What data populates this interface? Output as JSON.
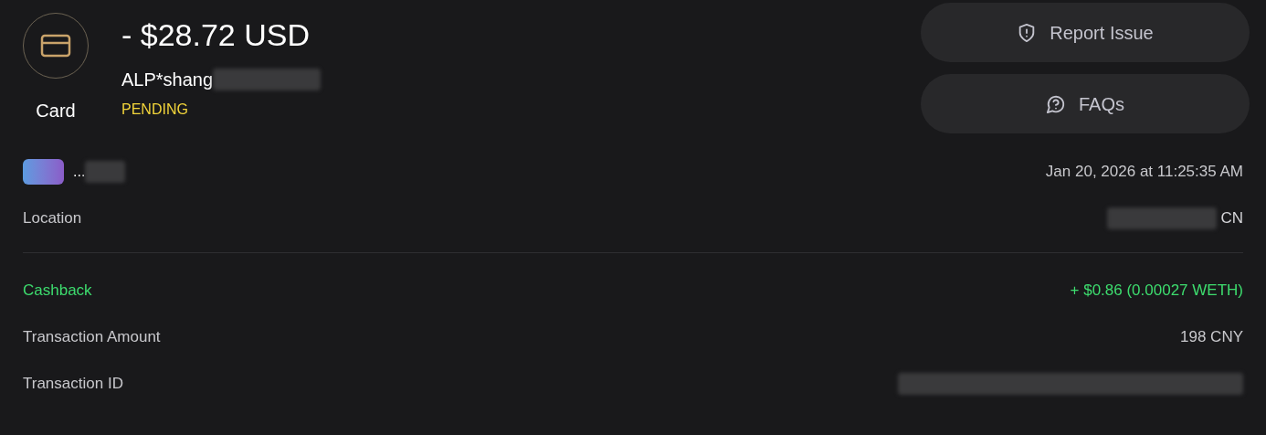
{
  "header": {
    "icon_label": "Card",
    "amount": "- $28.72 USD",
    "merchant": "ALP*shang",
    "status": "PENDING"
  },
  "actions": [
    {
      "kind": "report",
      "label": "Report Issue"
    },
    {
      "kind": "faq",
      "label": "FAQs"
    }
  ],
  "card": {
    "last_digits": "...",
    "date": "Jan 20, 2026 at 11:25:35 AM"
  },
  "location": {
    "label": "Location",
    "value": "CN"
  },
  "details": [
    {
      "kind": "cashback",
      "label": "Cashback",
      "value": "+ $0.86 (0.00027 WETH)"
    },
    {
      "kind": "plain",
      "label": "Transaction Amount",
      "value": "198 CNY"
    },
    {
      "kind": "redacted",
      "label": "Transaction ID"
    }
  ]
}
